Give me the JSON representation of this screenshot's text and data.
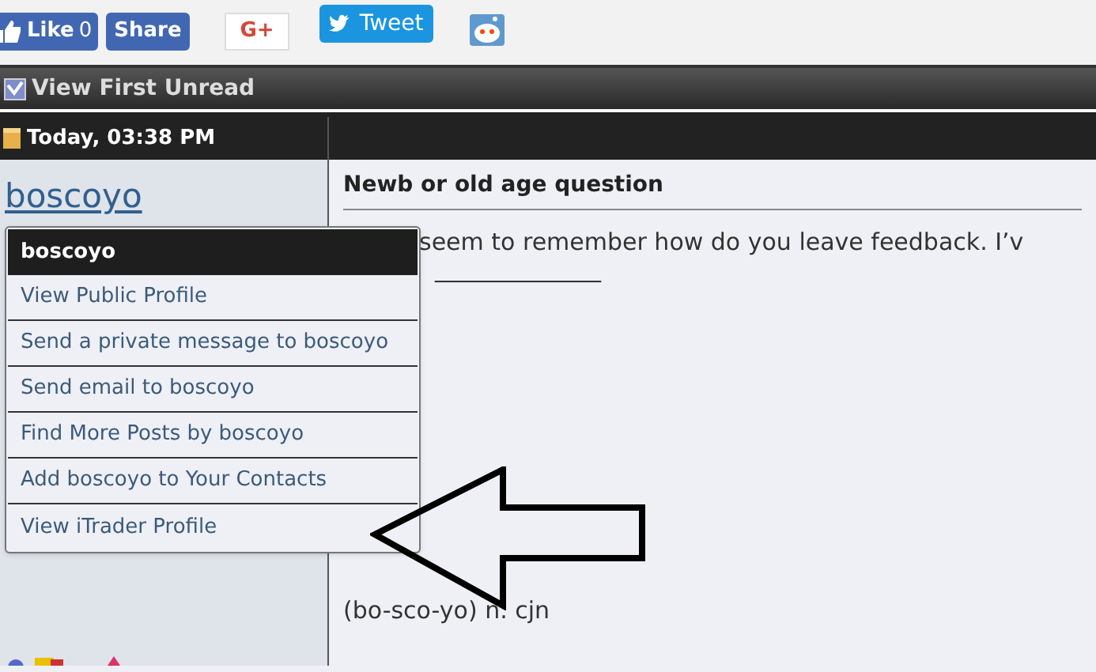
{
  "share_bar": {
    "like": {
      "label": "Like",
      "count": "0"
    },
    "share": "Share",
    "gplus": "G+",
    "tweet": "Tweet"
  },
  "toolbar": {
    "label": "View First Unread"
  },
  "post": {
    "date": "Today, 03:38 PM",
    "username": "boscoyo",
    "title": "Newb or old age question",
    "body": "seem to remember how do you leave feedback. I’v",
    "signature_rule": "______________",
    "signature": "(bo-sco-yo) n. cjn"
  },
  "user_menu": {
    "title": "boscoyo",
    "items": [
      "View Public Profile",
      "Send a private message to boscoyo",
      "Send email to boscoyo",
      "Find More Posts by boscoyo",
      "Add boscoyo to Your Contacts",
      "View iTrader Profile"
    ]
  }
}
